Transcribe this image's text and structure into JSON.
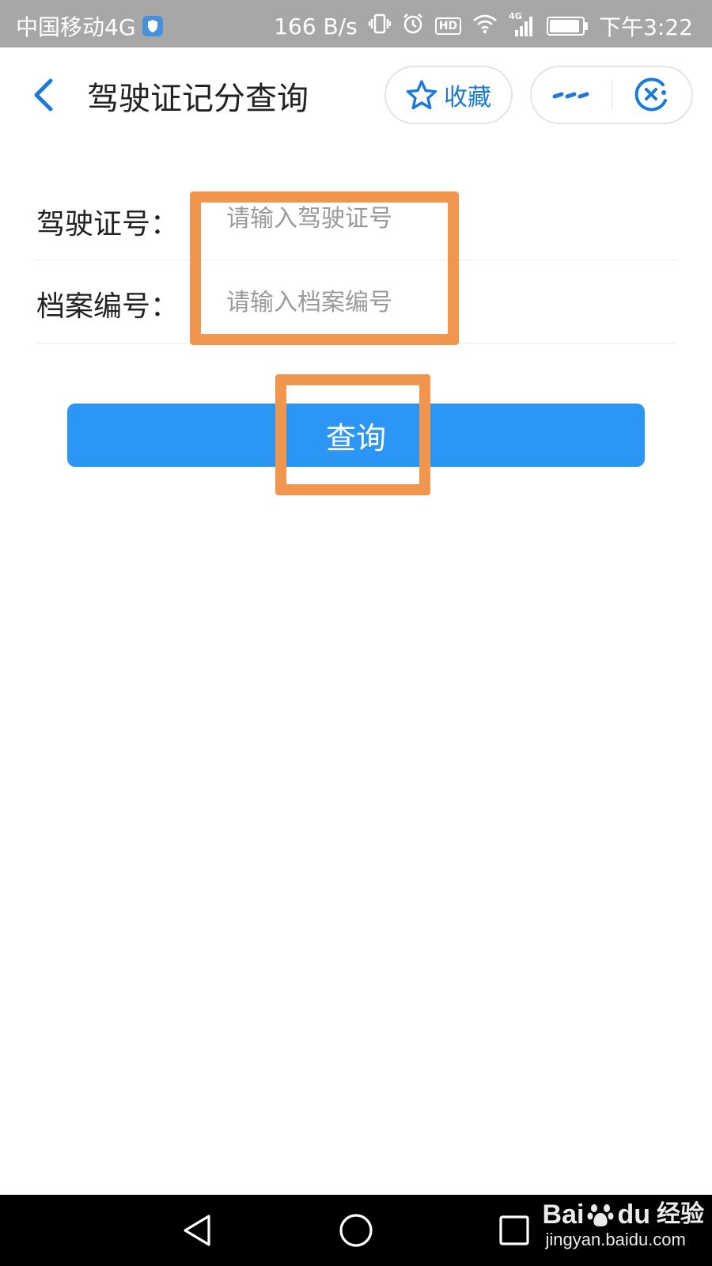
{
  "status_bar": {
    "carrier": "中国移动4G",
    "net_speed": "166 B/s",
    "hd": "HD",
    "network_type": "4G",
    "time": "下午3:22",
    "battery_level": 0.92,
    "icons": [
      "shield-icon",
      "vibrate-icon",
      "alarm-icon",
      "hd-icon",
      "wifi-icon",
      "signal-icon",
      "battery-icon"
    ]
  },
  "header": {
    "title": "驾驶证记分查询",
    "favorite_label": "收藏",
    "icons": [
      "back-arrow-icon",
      "star-icon",
      "more-icon",
      "close-icon"
    ]
  },
  "form": {
    "fields": [
      {
        "label": "驾驶证号：",
        "placeholder": "请输入驾驶证号",
        "value": ""
      },
      {
        "label": "档案编号：",
        "placeholder": "请输入档案编号",
        "value": ""
      }
    ],
    "submit_label": "查询"
  },
  "nav_bar": {
    "icons": [
      "back-triangle-icon",
      "home-circle-icon",
      "recents-square-icon"
    ]
  },
  "watermark": {
    "brand_left": "Bai",
    "brand_right": "du",
    "brand_cn": "经验",
    "url": "jingyan.baidu.com"
  },
  "colors": {
    "accent": "#2b96f4",
    "link_blue": "#1a7ad9",
    "highlight": "#f0964f",
    "status_bar": "#a7a7a7"
  }
}
